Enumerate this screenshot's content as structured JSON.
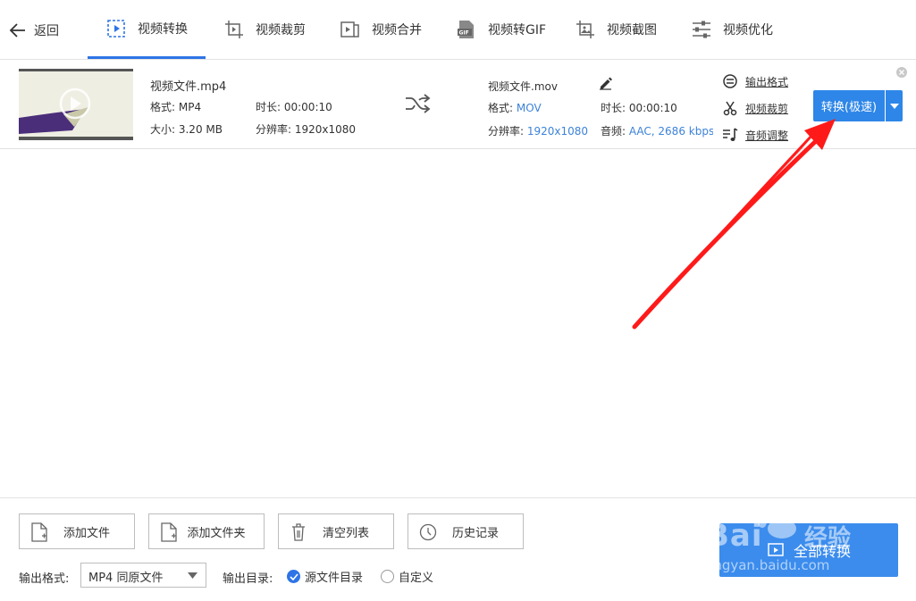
{
  "nav": {
    "back_label": "返回",
    "tabs": [
      {
        "label": "视频转换",
        "icon": "video-convert-icon",
        "active": true
      },
      {
        "label": "视频裁剪",
        "icon": "video-crop-icon"
      },
      {
        "label": "视频合并",
        "icon": "video-merge-icon"
      },
      {
        "label": "视频转GIF",
        "icon": "gif-icon"
      },
      {
        "label": "视频截图",
        "icon": "screenshot-icon"
      },
      {
        "label": "视频优化",
        "icon": "sliders-icon"
      }
    ]
  },
  "file": {
    "source": {
      "name": "视频文件.mp4",
      "format_label": "格式: MP4",
      "duration_label": "时长: 00:00:10",
      "size_label": "大小: 3.20 MB",
      "resolution_label": "分辨率: 1920x1080"
    },
    "output": {
      "name": "视频文件.mov",
      "format_key": "格式: ",
      "format_value": "MOV",
      "duration_label": "时长: 00:00:10",
      "resolution_key": "分辨率: ",
      "resolution_value": "1920x1080",
      "audio_key": "音频: ",
      "audio_value": "AAC, 2686 kbps"
    },
    "links": {
      "output_format": "输出格式",
      "video_crop": "视频裁剪",
      "audio_adjust": "音频调整"
    },
    "convert_label": "转换(极速)"
  },
  "bottom": {
    "add_file": "添加文件",
    "add_folder": "添加文件夹",
    "clear_list": "清空列表",
    "history": "历史记录",
    "output_format_label": "输出格式:",
    "output_format_value": "MP4 同原文件",
    "output_dir_label": "输出目录:",
    "dir_source": "源文件目录",
    "dir_custom": "自定义",
    "convert_all": "全部转换"
  },
  "watermark": {
    "brand": "Bai",
    "cn": "经验",
    "url": "jingyan.baidu.com"
  },
  "colors": {
    "accent": "#2e74e6",
    "button": "#2e86e8",
    "annotation": "#ff1a1a"
  }
}
